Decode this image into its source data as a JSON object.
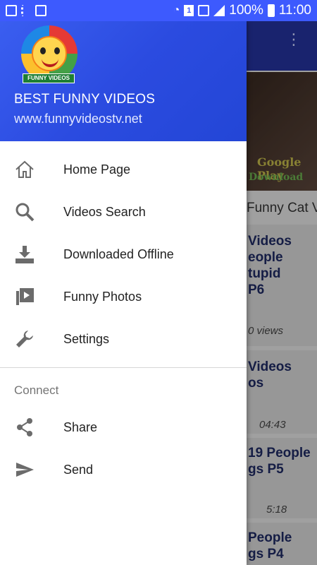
{
  "status_bar": {
    "battery": "100%",
    "time": "11:00",
    "sim": "1"
  },
  "drawer": {
    "logo_banner": "FUNNY VIDEOS",
    "title": "BEST FUNNY VIDEOS",
    "url": "www.funnyvideostv.net",
    "items": [
      {
        "label": "Home Page",
        "icon": "home-icon"
      },
      {
        "label": "Videos Search",
        "icon": "search-icon"
      },
      {
        "label": "Downloaded Offline",
        "icon": "download-icon"
      },
      {
        "label": "Funny Photos",
        "icon": "video-library-icon"
      },
      {
        "label": "Settings",
        "icon": "wrench-icon"
      }
    ],
    "section_title": "Connect",
    "connect_items": [
      {
        "label": "Share",
        "icon": "share-icon"
      },
      {
        "label": "Send",
        "icon": "send-icon"
      }
    ]
  },
  "background": {
    "banner_line1": "Google Play",
    "banner_line2": "Download",
    "title_line": "Funny Cat V",
    "card1_lines": [
      "Videos",
      "eople",
      "tupid",
      "P6"
    ],
    "card1_meta": "0 views",
    "card2_lines": [
      "Videos",
      "os"
    ],
    "card2_meta": "04:43",
    "card3_lines": [
      "19  People",
      "gs P5"
    ],
    "card3_meta": "5:18",
    "card4_lines": [
      "People",
      "gs P4"
    ]
  },
  "colors": {
    "status_bar": "#3d5afe",
    "drawer_header": "#2b4be0",
    "toolbar": "#24339e"
  }
}
